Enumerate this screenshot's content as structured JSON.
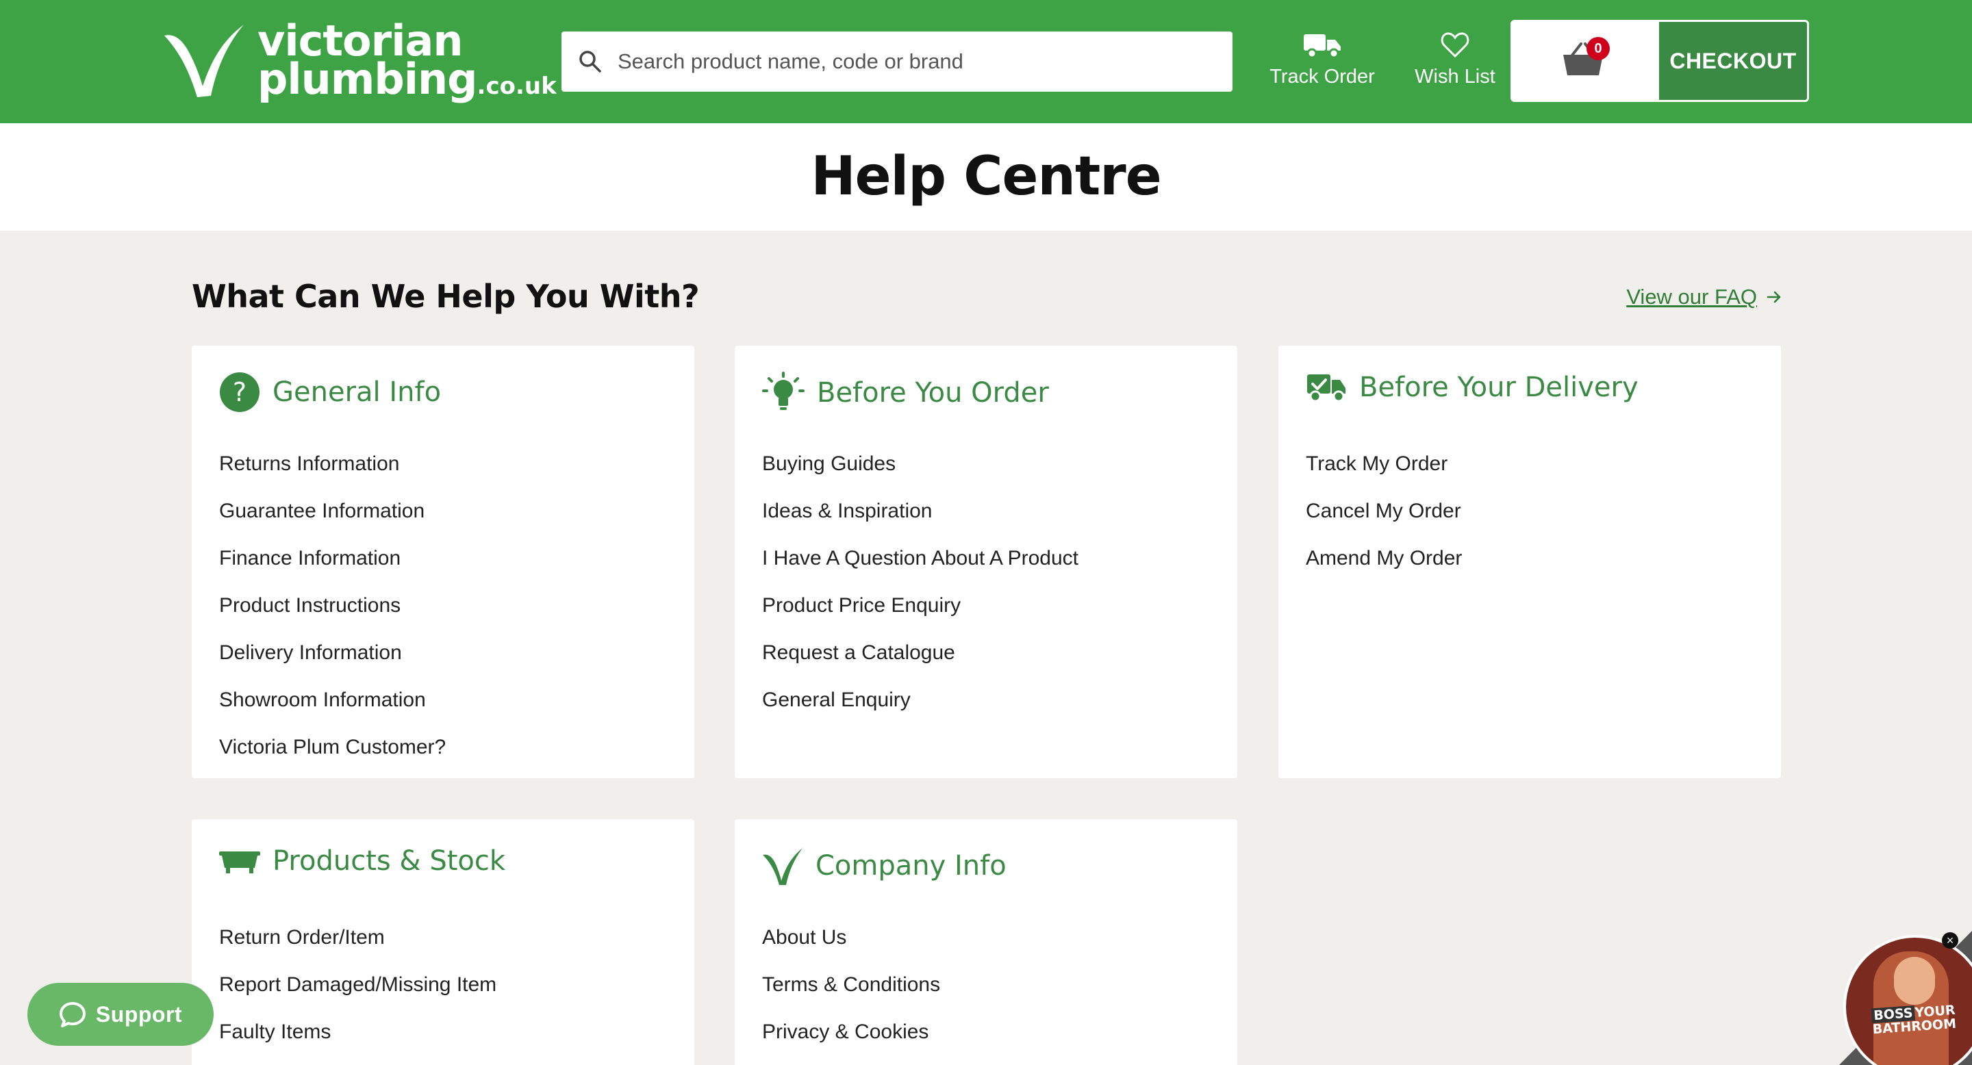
{
  "header": {
    "logo": {
      "line1": "victorian",
      "line2": "plumbing",
      "suffix": ".co.uk"
    },
    "search": {
      "placeholder": "Search product name, code or brand"
    },
    "track_order": "Track Order",
    "wish_list": "Wish List",
    "basket_count": "0",
    "checkout": "CHECKOUT",
    "colors": {
      "brand_green": "#3da345",
      "checkout_green": "#3a8a44",
      "badge_red": "#d0021b"
    }
  },
  "page": {
    "title": "Help Centre",
    "section_heading": "What Can We Help You With?",
    "faq_link": "View our FAQ"
  },
  "cards": [
    {
      "title": "General Info",
      "icon": "question-circle-icon",
      "items": [
        "Returns Information",
        "Guarantee Information",
        "Finance Information",
        "Product Instructions",
        "Delivery Information",
        "Showroom Information",
        "Victoria Plum Customer?"
      ]
    },
    {
      "title": "Before You Order",
      "icon": "lightbulb-icon",
      "items": [
        "Buying Guides",
        "Ideas & Inspiration",
        "I Have A Question About A Product",
        "Product Price Enquiry",
        "Request a Catalogue",
        "General Enquiry"
      ]
    },
    {
      "title": "Before Your Delivery",
      "icon": "delivery-truck-check-icon",
      "items": [
        "Track My Order",
        "Cancel My Order",
        "Amend My Order"
      ]
    },
    {
      "title": "Products & Stock",
      "icon": "bathtub-icon",
      "items": [
        "Return Order/Item",
        "Report Damaged/Missing Item",
        "Faulty Items"
      ]
    },
    {
      "title": "Company Info",
      "icon": "vp-tick-icon",
      "items": [
        "About Us",
        "Terms & Conditions",
        "Privacy & Cookies"
      ]
    }
  ],
  "support": {
    "label": "Support"
  },
  "video": {
    "line1": "BOSS",
    "line2": "YOUR",
    "line3": "BATHROOM"
  }
}
